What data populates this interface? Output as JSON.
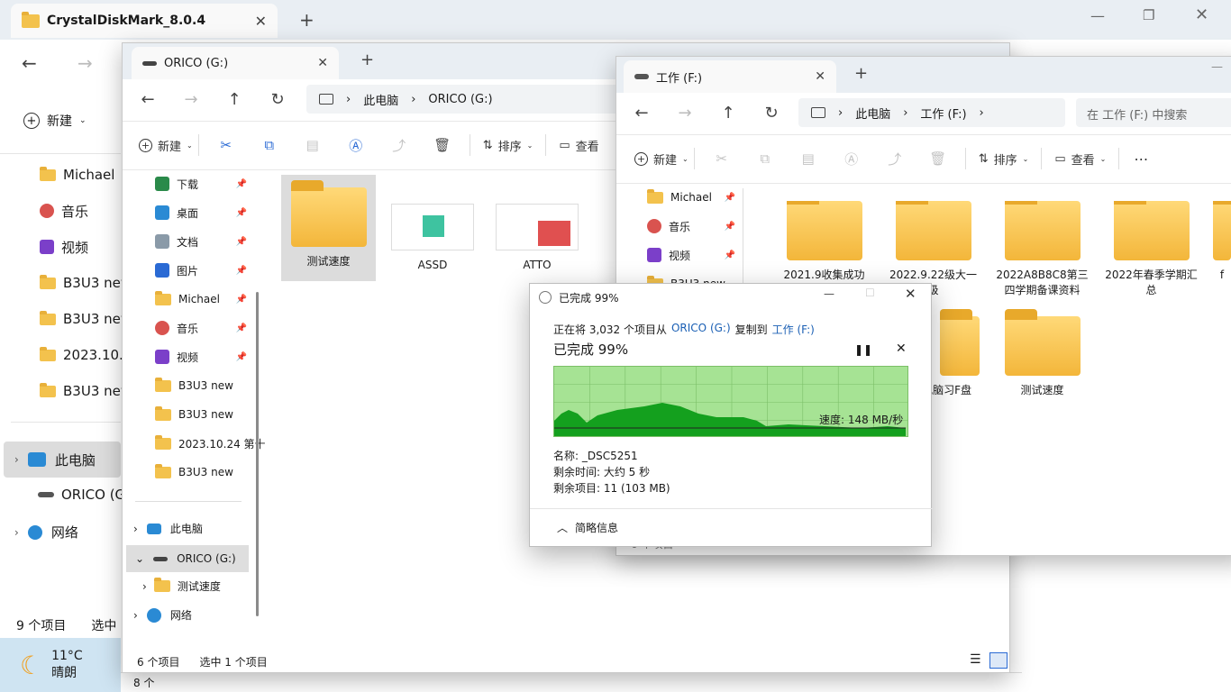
{
  "window_main": {
    "tab_title": "CrystalDiskMark_8.0.4",
    "sidebar": [
      "Michael",
      "音乐",
      "视频",
      "B3U3 new",
      "B3U3 new",
      "2023.10.2",
      "B3U3 new"
    ],
    "this_pc": "此电脑",
    "orico": "ORICO (G",
    "network": "网络",
    "new_btn": "新建",
    "status_items": "9 个项目",
    "status_selected": "选中"
  },
  "weather": {
    "temp": "11°C",
    "cond": "晴朗"
  },
  "window_orico": {
    "tab_title": "ORICO (G:)",
    "crumbs": [
      "此电脑",
      "ORICO (G:)"
    ],
    "cmd": {
      "new": "新建",
      "sort": "排序",
      "view": "查看"
    },
    "quick": [
      {
        "label": "下载",
        "icon": "download-icon"
      },
      {
        "label": "桌面",
        "icon": "desktop-icon"
      },
      {
        "label": "文档",
        "icon": "document-icon"
      },
      {
        "label": "图片",
        "icon": "pictures-icon"
      },
      {
        "label": "Michael",
        "icon": "folder-icon"
      },
      {
        "label": "音乐",
        "icon": "music-icon"
      },
      {
        "label": "视频",
        "icon": "video-icon"
      },
      {
        "label": "B3U3 new",
        "icon": "folder-icon"
      },
      {
        "label": "B3U3 new",
        "icon": "folder-icon"
      },
      {
        "label": "2023.10.24 第十",
        "icon": "folder-icon"
      },
      {
        "label": "B3U3 new",
        "icon": "folder-icon"
      }
    ],
    "tree": {
      "pc": "此电脑",
      "drive": "ORICO (G:)",
      "child": "测试速度",
      "network": "网络"
    },
    "files": [
      "测试速度",
      "ASSD",
      "ATTO"
    ],
    "status_items": "6 个项目",
    "status_selected": "选中 1 个项目",
    "behind_status": "8 个"
  },
  "window_work": {
    "tab_title": "工作 (F:)",
    "crumbs": [
      "此电脑",
      "工作 (F:)"
    ],
    "search_placeholder": "在 工作 (F:) 中搜索",
    "cmd": {
      "new": "新建",
      "sort": "排序",
      "view": "查看"
    },
    "sidebar": [
      {
        "label": "Michael",
        "icon": "folder-icon"
      },
      {
        "label": "音乐",
        "icon": "music-icon"
      },
      {
        "label": "视频",
        "icon": "video-icon"
      },
      {
        "label": "B3U3 new",
        "icon": "folder-icon"
      }
    ],
    "files_row1": [
      "2021.9收集成功",
      "2022.9.22级大一级",
      "2022A8B8C8第三四学期备课资料",
      "2022年春季学期汇总",
      "f"
    ],
    "files_row2": [
      "黑红电脑习F盘",
      "测试速度"
    ],
    "status_items": "6 个项目"
  },
  "dialog": {
    "title": "已完成 99%",
    "line_prefix": "正在将 3,032 个项目从",
    "source": "ORICO (G:)",
    "line_mid": "复制到",
    "dest": "工作 (F:)",
    "progress_text": "已完成 99%",
    "progress": 0.99,
    "speed": "速度: 148 MB/秒",
    "name": "名称: _DSC5251",
    "remaining_time": "剩余时间: 大约 5 秒",
    "remaining_items": "剩余项目: 11 (103 MB)",
    "details_toggle": "简略信息",
    "colors": {
      "graph_bg": "#a6e394",
      "graph_fill": "#14a01e",
      "graph_border": "#7bbf67"
    }
  }
}
